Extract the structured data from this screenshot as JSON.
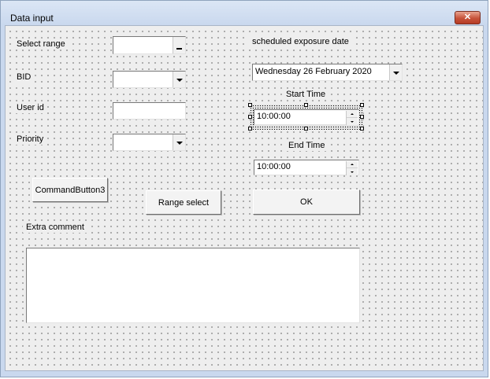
{
  "window": {
    "title": "Data input",
    "close_icon": "close-icon"
  },
  "labels": {
    "select_range": "Select range",
    "bid": "BID",
    "user_id": "User id",
    "priority": "Priority",
    "scheduled_exposure_date": "scheduled exposure date",
    "start_time": "Start Time",
    "end_time": "End Time",
    "extra_comment": "Extra comment"
  },
  "fields": {
    "select_range": "",
    "bid": "",
    "user_id": "",
    "priority": "",
    "exposure_date": "Wednesday 26  February  2020",
    "start_time": "10:00:00",
    "end_time": "10:00:00",
    "extra_comment": ""
  },
  "buttons": {
    "command_button3": "CommandButton3",
    "range_select": "Range select",
    "ok": "OK"
  },
  "colors": {
    "title_bar": "#c9d8ee",
    "close_button": "#c7533b",
    "form_background": "#eeeeee"
  }
}
